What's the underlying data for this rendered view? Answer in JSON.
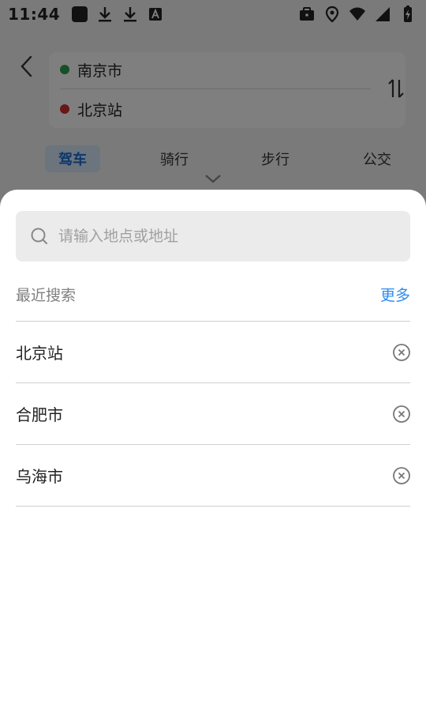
{
  "status_bar": {
    "time": "11:44",
    "left_icons": [
      "app-square-icon",
      "download-icon",
      "download-icon",
      "font-icon"
    ],
    "right_icons": [
      "briefcase-icon",
      "location-icon",
      "wifi-icon",
      "signal-icon",
      "battery-charging-icon"
    ]
  },
  "route": {
    "start": {
      "label": "南京市",
      "dot_color": "#2e9e4f"
    },
    "end": {
      "label": "北京站",
      "dot_color": "#d32f2f"
    }
  },
  "modes": [
    {
      "label": "驾车",
      "active": true
    },
    {
      "label": "骑行",
      "active": false
    },
    {
      "label": "步行",
      "active": false
    },
    {
      "label": "公交",
      "active": false
    }
  ],
  "search": {
    "placeholder": "请输入地点或地址",
    "value": ""
  },
  "recent": {
    "title": "最近搜索",
    "more_label": "更多",
    "items": [
      {
        "label": "北京站"
      },
      {
        "label": "合肥市"
      },
      {
        "label": "乌海市"
      }
    ]
  },
  "colors": {
    "accent": "#2a8cf0",
    "active_tab_bg": "#d9e8fb",
    "active_tab_text": "#1a6fd8",
    "overlay": "rgba(0,0,0,0.5)"
  }
}
